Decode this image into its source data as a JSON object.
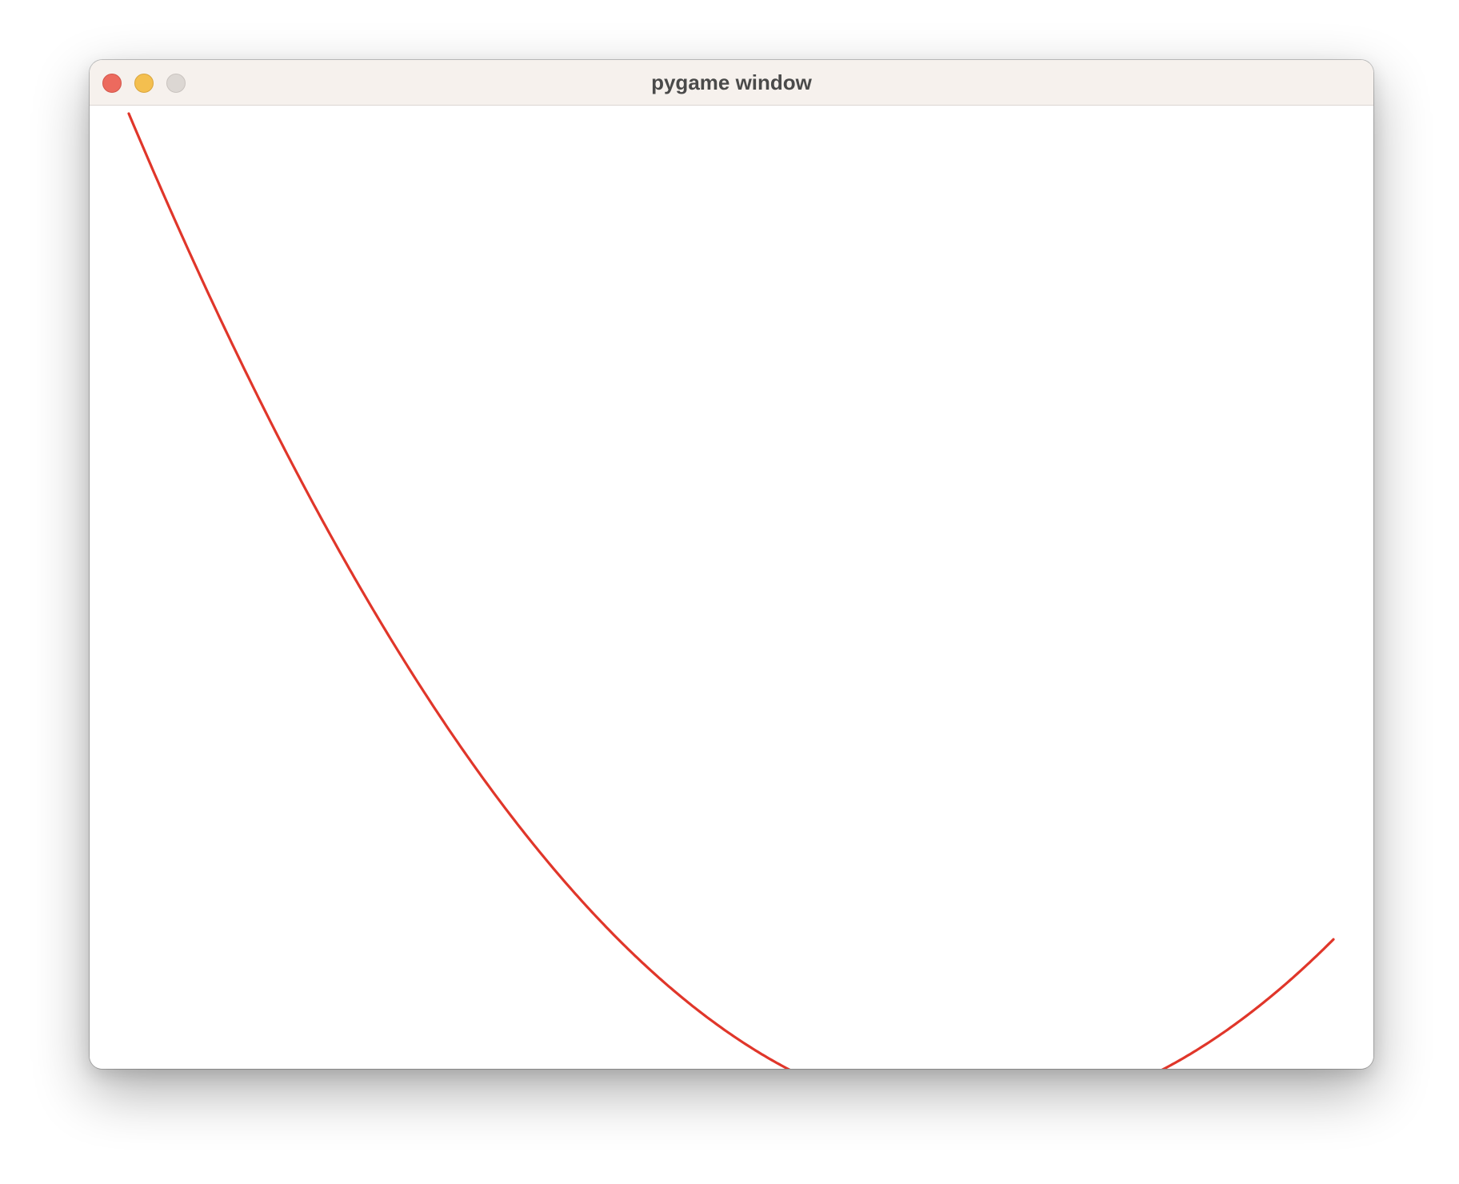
{
  "window": {
    "title": "pygame window"
  },
  "buttons": {
    "close_icon": "close-icon",
    "minimize_icon": "minimize-icon",
    "zoom_icon": "zoom-icon"
  },
  "canvas": {
    "background": "#ffffff"
  },
  "curve": {
    "color": "#e0362a",
    "shape": "parabola"
  }
}
